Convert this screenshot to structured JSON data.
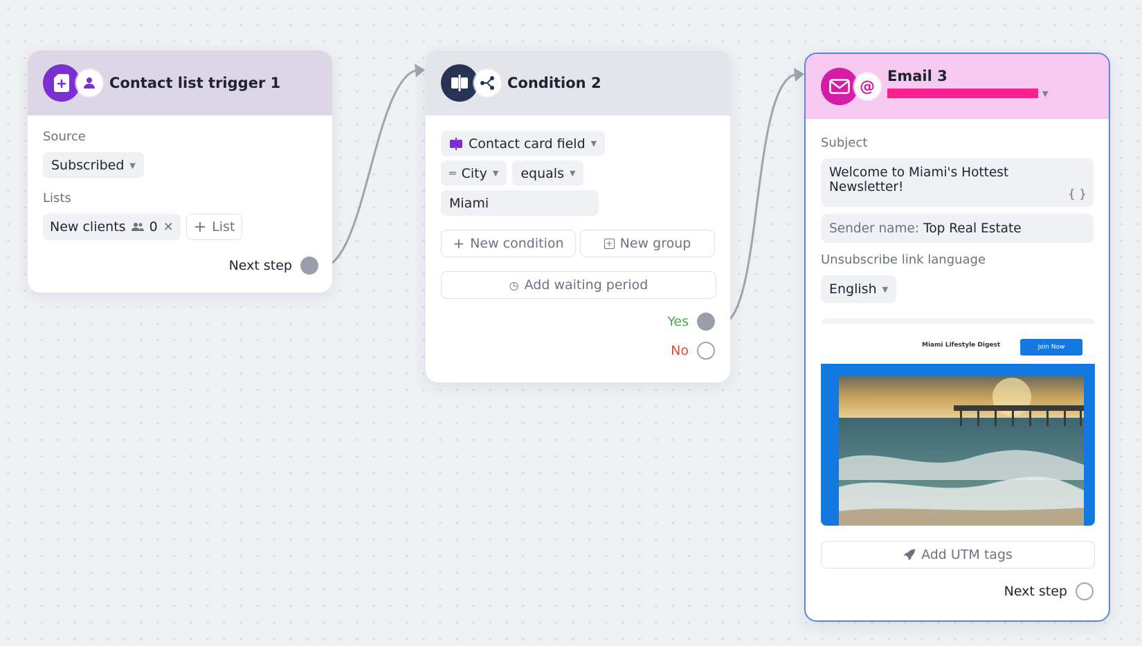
{
  "trigger": {
    "title": "Contact list trigger 1",
    "source_label": "Source",
    "source_value": "Subscribed",
    "lists_label": "Lists",
    "list_chip": {
      "name": "New clients",
      "count": "0"
    },
    "add_list_label": "List",
    "next_step_label": "Next step"
  },
  "condition": {
    "title": "Condition 2",
    "field_type": "Contact card field",
    "field_name": "City",
    "operator": "equals",
    "value": "Miami",
    "new_condition_label": "New condition",
    "new_group_label": "New group",
    "waiting_label": "Add waiting period",
    "yes_label": "Yes",
    "no_label": "No"
  },
  "email": {
    "title": "Email 3",
    "subject_label": "Subject",
    "subject_value": "Welcome to Miami's Hottest Newsletter!",
    "variables_label": "{ }",
    "sender_prefix": "Sender name:",
    "sender_value": "Top Real Estate",
    "unsub_label": "Unsubscribe link language",
    "language_value": "English",
    "preview": {
      "brand": "Miami Lifestyle Digest",
      "cta": "Join Now"
    },
    "utm_label": "Add UTM tags",
    "next_step_label": "Next step"
  },
  "colors": {
    "trigger_purple": "#7b2fd0",
    "trigger_header": "#dcd6e6",
    "condition_navy": "#263354",
    "condition_header": "#e3e5eb",
    "email_magenta": "#d41ca6",
    "email_header": "#f6c9f0",
    "email_border": "#5d86d6",
    "yes_green": "#3fae4c",
    "no_red": "#e2493b",
    "redaction": "#ff1f8e",
    "preview_blue": "#1379e0"
  }
}
